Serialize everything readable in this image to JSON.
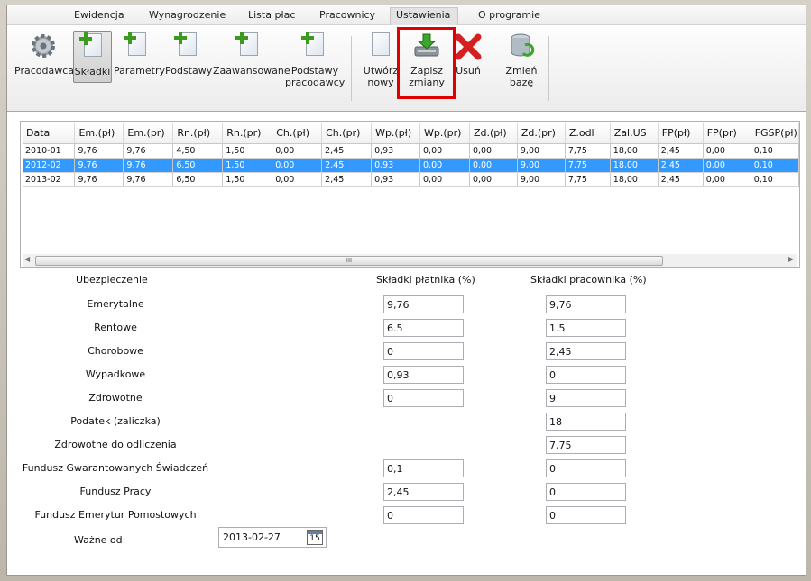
{
  "tabs": [
    "Ewidencja",
    "Wynagrodzenie",
    "Lista płac",
    "Pracownicy",
    "Ustawienia",
    "O programie"
  ],
  "ribbon": {
    "pracodawca": "Pracodawca",
    "skladki": "Składki",
    "parametry": "Parametry",
    "podstawy": "Podstawy",
    "zaawansowane": "Zaawansowane",
    "podstawy_prac_1": "Podstawy",
    "podstawy_prac_2": "pracodawcy",
    "utworz_1": "Utwórz",
    "utworz_2": "nowy",
    "zapisz_1": "Zapisz",
    "zapisz_2": "zmiany",
    "usun": "Usuń",
    "zmien_1": "Zmień",
    "zmien_2": "bazę"
  },
  "grid": {
    "columns": [
      "Data",
      "Em.(pł)",
      "Em.(pr)",
      "Rn.(pł)",
      "Rn.(pr)",
      "Ch.(pł)",
      "Ch.(pr)",
      "Wp.(pł)",
      "Wp.(pr)",
      "Zd.(pł)",
      "Zd.(pr)",
      "Z.odl",
      "Zal.US",
      "FP(pł)",
      "FP(pr)",
      "FGSP(pł)"
    ],
    "rows": [
      [
        "2010-01",
        "9,76",
        "9,76",
        "4,50",
        "1,50",
        "0,00",
        "2,45",
        "0,93",
        "0,00",
        "0,00",
        "9,00",
        "7,75",
        "18,00",
        "2,45",
        "0,00",
        "0,10"
      ],
      [
        "2012-02",
        "9,76",
        "9,76",
        "6,50",
        "1,50",
        "0,00",
        "2,45",
        "0,93",
        "0,00",
        "0,00",
        "9,00",
        "7,75",
        "18,00",
        "2,45",
        "0,00",
        "0,10"
      ],
      [
        "2013-02",
        "9,76",
        "9,76",
        "6,50",
        "1,50",
        "0,00",
        "2,45",
        "0,93",
        "0,00",
        "0,00",
        "9,00",
        "7,75",
        "18,00",
        "2,45",
        "0,00",
        "0,10"
      ]
    ],
    "selected_row": 1,
    "scroll_grip": "III"
  },
  "form": {
    "header_ubezp": "Ubezpieczenie",
    "header_platnik": "Składki płatnika (%)",
    "header_pracownik": "Składki pracownika (%)",
    "rows": [
      {
        "label": "Emerytalne",
        "platnik": "9,76",
        "pracownik": "9,76"
      },
      {
        "label": "Rentowe",
        "platnik": "6.5",
        "pracownik": "1.5"
      },
      {
        "label": "Chorobowe",
        "platnik": "0",
        "pracownik": "2,45"
      },
      {
        "label": "Wypadkowe",
        "platnik": "0,93",
        "pracownik": "0"
      },
      {
        "label": "Zdrowotne",
        "platnik": "0",
        "pracownik": "9"
      },
      {
        "label": "Podatek (zaliczka)",
        "platnik": null,
        "pracownik": "18"
      },
      {
        "label": "Zdrowotne do odliczenia",
        "platnik": null,
        "pracownik": "7,75"
      },
      {
        "label": "Fundusz Gwarantowanych Świadczeń",
        "platnik": "0,1",
        "pracownik": "0"
      },
      {
        "label": "Fundusz Pracy",
        "platnik": "2,45",
        "pracownik": "0"
      },
      {
        "label": "Fundusz Emerytur Pomostowych",
        "platnik": "0",
        "pracownik": "0"
      }
    ],
    "wazne_od_label": "Ważne od:",
    "wazne_od_value": "2013-02-27",
    "calendar_day": "15"
  },
  "colors": {
    "selection": "#3399ff",
    "highlight_border": "#e00000"
  }
}
